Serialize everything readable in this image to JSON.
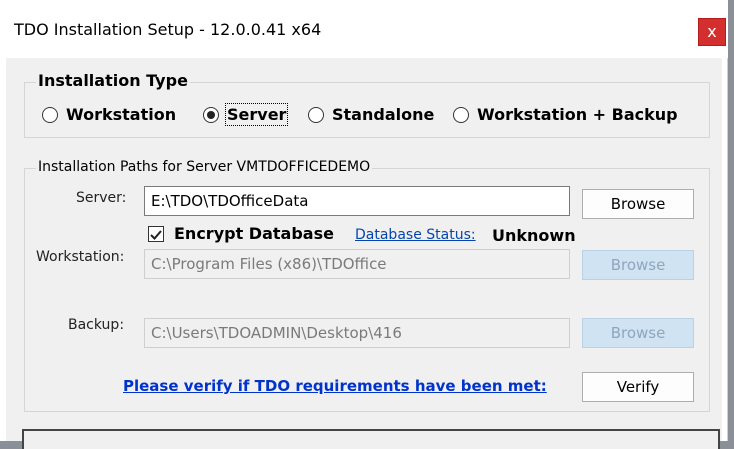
{
  "window": {
    "title": "TDO Installation Setup - 12.0.0.41 x64",
    "close_glyph": "x"
  },
  "installation_type": {
    "title": "Installation Type",
    "options": [
      {
        "label": "Workstation",
        "selected": false
      },
      {
        "label": "Server",
        "selected": true
      },
      {
        "label": "Standalone",
        "selected": false
      },
      {
        "label": "Workstation + Backup",
        "selected": false
      }
    ]
  },
  "paths": {
    "title": "Installation Paths for Server VMTDOFFICEDEMO",
    "server_label": "Server:",
    "server_value": "E:\\TDO\\TDOfficeData",
    "browse_label": "Browse",
    "encrypt_label": "Encrypt Database",
    "encrypt_checked": true,
    "db_status_link": "Database Status:",
    "db_status_value": "Unknown",
    "workstation_label": "Workstation:",
    "workstation_value": "C:\\Program Files (x86)\\TDOffice",
    "backup_label": "Backup:",
    "backup_value": "C:\\Users\\TDOADMIN\\Desktop\\416"
  },
  "verify": {
    "link": "Please verify if TDO requirements have been met:",
    "button": "Verify"
  }
}
